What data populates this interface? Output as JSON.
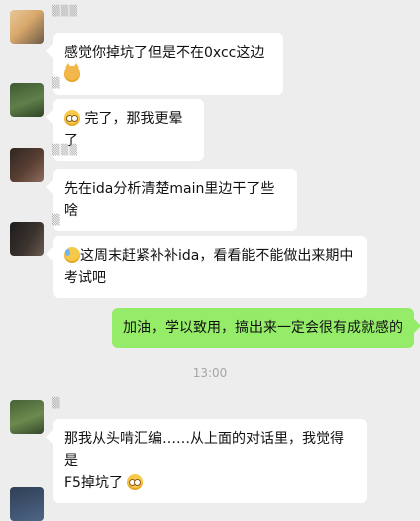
{
  "messages": [
    {
      "side": "left",
      "avatar": "avatar-1",
      "text": "感觉你掉坑了但是不在0xcc这边",
      "emoji_after": "grinning-cat-icon"
    },
    {
      "side": "left",
      "avatar": "avatar-2",
      "emoji_before": "flushed-face-icon",
      "text": "完了，那我更晕了"
    },
    {
      "side": "left",
      "avatar": "avatar-3",
      "text": "先在ida分析清楚main里边干了些啥"
    },
    {
      "side": "left",
      "avatar": "avatar-4",
      "emoji_before": "sweat-smile-icon",
      "line1": "这周末赶紧补补ida，看看能不能做出来期中",
      "line2": "考试吧"
    },
    {
      "side": "right",
      "text": "加油，学以致用，搞出来一定会很有成就感的"
    },
    {
      "side": "left",
      "avatar": "avatar-5",
      "line1": "那我从头啃汇编……从上面的对话里，我觉得是",
      "line2": "F5掉坑了",
      "emoji_after": "flushed-face-icon"
    }
  ],
  "timestamp": "13:00"
}
